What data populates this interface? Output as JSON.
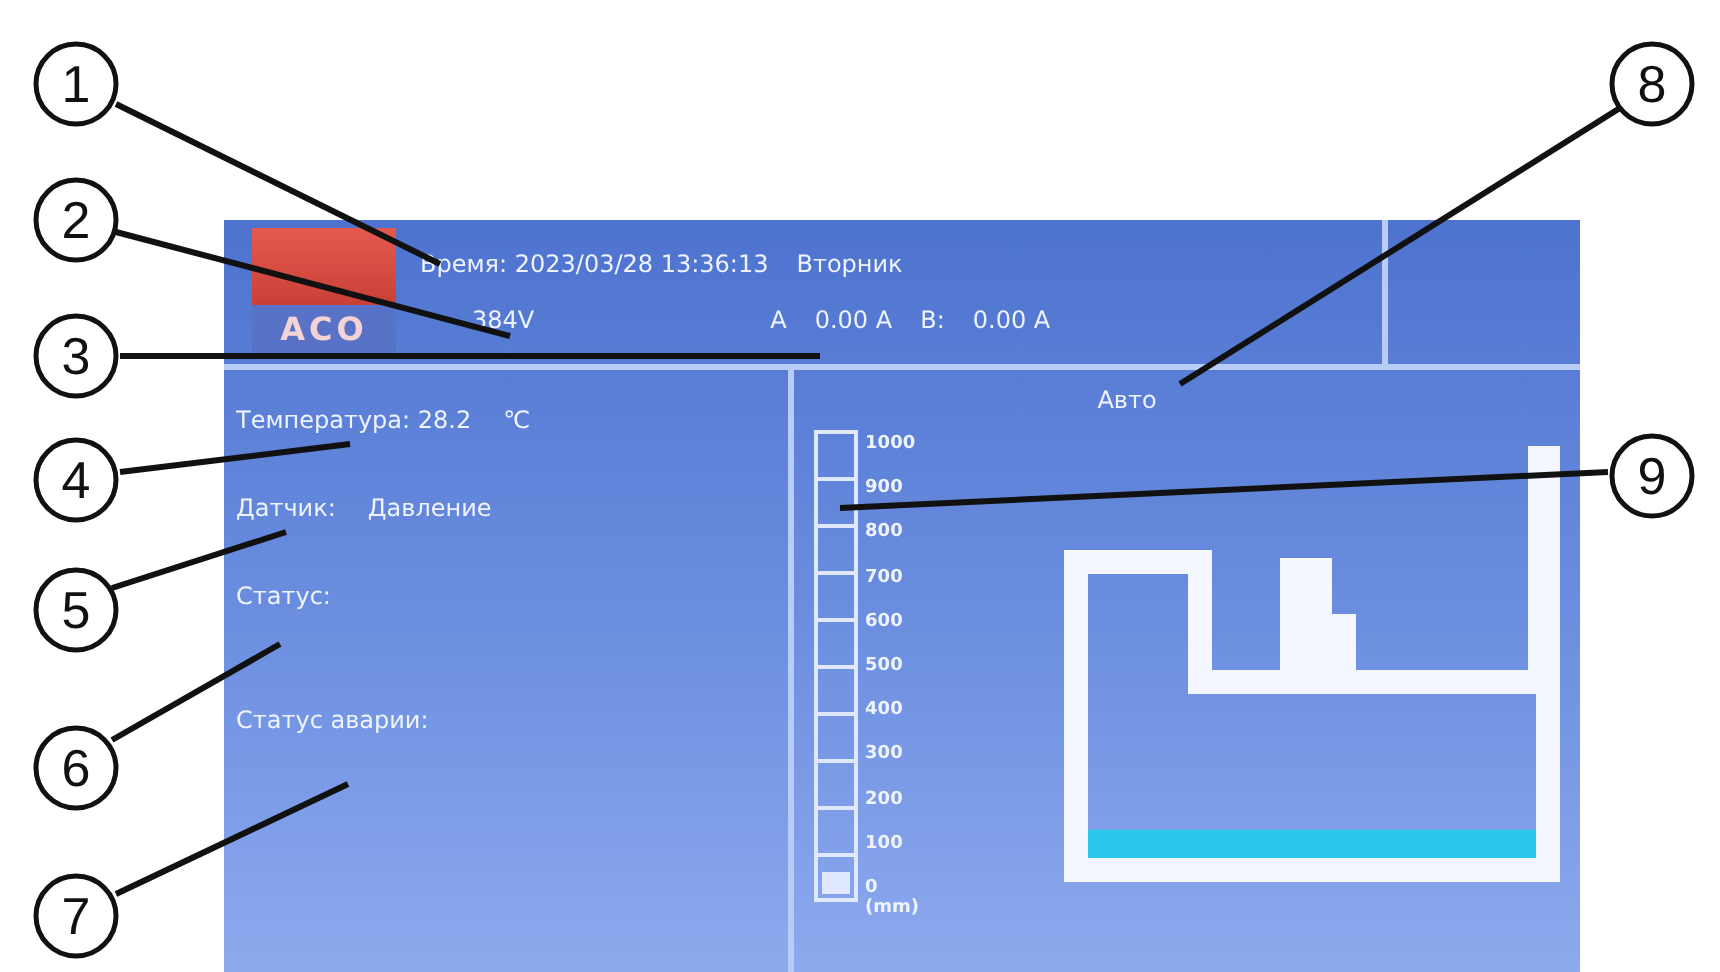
{
  "callouts": [
    {
      "number": "1"
    },
    {
      "number": "2"
    },
    {
      "number": "3"
    },
    {
      "number": "4"
    },
    {
      "number": "5"
    },
    {
      "number": "6"
    },
    {
      "number": "7"
    },
    {
      "number": "8"
    },
    {
      "number": "9"
    }
  ],
  "header": {
    "logo": "ACO",
    "datetime": "Время: 2023/03/28 13:36:13",
    "weekday": "Вторник",
    "voltage": "384V",
    "current_a_label": "A",
    "current_a": "0.00 A",
    "current_b_label": "B:",
    "current_b": "0.00 A"
  },
  "left_panel": {
    "temperature_label": "Температура:",
    "temperature": "28.2",
    "temperature_unit": "℃",
    "sensor_label": "Датчик:",
    "sensor": "Давление",
    "status_label": "Статус:",
    "alarm_label": "Статус аварии:"
  },
  "right_panel": {
    "mode": "Авто",
    "gauge": {
      "ticks": [
        "1000",
        "900",
        "800",
        "700",
        "600",
        "500",
        "400",
        "300",
        "200",
        "100"
      ],
      "zero_label": "0 (mm)",
      "level": 0.05
    }
  }
}
